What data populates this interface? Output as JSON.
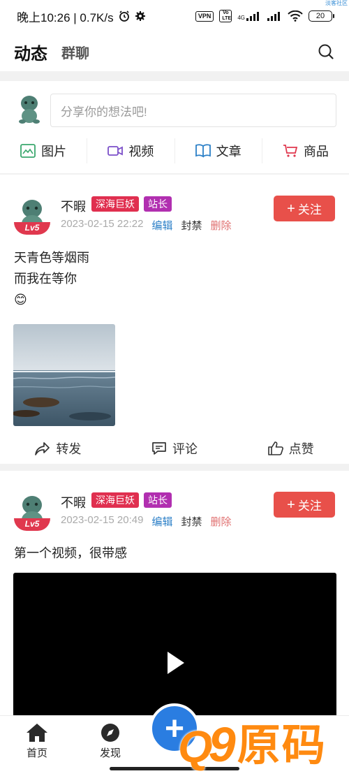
{
  "status_bar": {
    "time": "晚上10:26 | 0.7K/s",
    "vpn": "VPN",
    "volte": "Vo LTE",
    "net": "4G",
    "battery": "20",
    "corner_watermark": "淡客社区"
  },
  "header": {
    "tab_active": "动态",
    "tab_group": "群聊",
    "search_icon": "search-icon"
  },
  "composer": {
    "placeholder": "分享你的想法吧!",
    "actions": [
      {
        "label": "图片",
        "icon": "image-icon",
        "color": "#3aa76d"
      },
      {
        "label": "视频",
        "icon": "video-camera-icon",
        "color": "#7b4fc9"
      },
      {
        "label": "文章",
        "icon": "book-icon",
        "color": "#2b7fc7"
      },
      {
        "label": "商品",
        "icon": "cart-icon",
        "color": "#e0384e"
      }
    ]
  },
  "posts": [
    {
      "username": "不暇",
      "level": "Lv5",
      "tag1": "深海巨妖",
      "tag2": "站长",
      "time": "2023-02-15 22:22",
      "edit": "编辑",
      "ban": "封禁",
      "delete": "删除",
      "follow": "关注",
      "lines": [
        "天青色等烟雨",
        "而我在等你",
        "😊"
      ],
      "actions": {
        "repost": "转发",
        "comment": "评论",
        "like": "点赞"
      }
    },
    {
      "username": "不暇",
      "level": "Lv5",
      "tag1": "深海巨妖",
      "tag2": "站长",
      "time": "2023-02-15 20:49",
      "edit": "编辑",
      "ban": "封禁",
      "delete": "删除",
      "follow": "关注",
      "text": "第一个视频，很带感"
    }
  ],
  "bottom_nav": {
    "home": "首页",
    "discover": "发现",
    "fab": "+"
  },
  "watermark": {
    "q": "Q",
    "nine": "9",
    "text": "原码"
  },
  "colors": {
    "accent_red": "#e8504a",
    "tag_red": "#e02f4f",
    "tag_purple": "#b12fb0",
    "link_blue": "#2b7fc7",
    "fab_blue": "#2a7de1"
  }
}
